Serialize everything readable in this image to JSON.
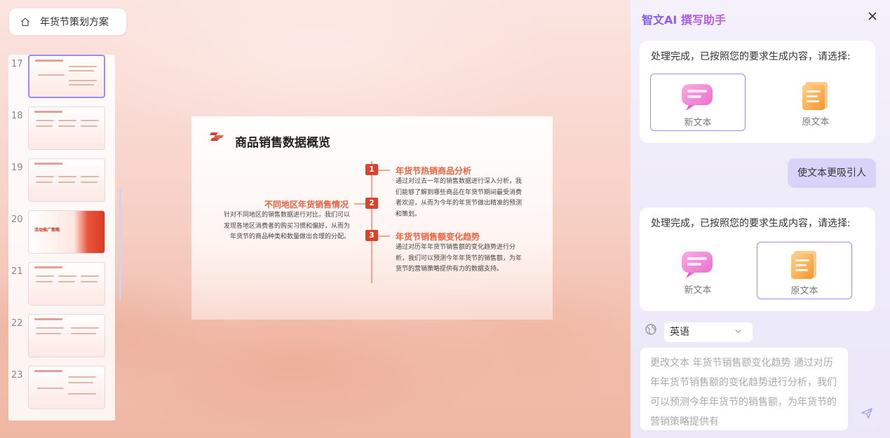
{
  "topbar": {
    "doc_title": "年货节策划方案"
  },
  "thumbnails": [
    {
      "num": "17",
      "active": true
    },
    {
      "num": "18"
    },
    {
      "num": "19"
    },
    {
      "num": "20",
      "badge": "活动推广策略"
    },
    {
      "num": "21"
    },
    {
      "num": "22"
    },
    {
      "num": "23"
    }
  ],
  "slide": {
    "title": "商品销售数据概览",
    "sections": [
      {
        "num": "1",
        "heading": "年货节热销商品分析",
        "body": "通过对过去一年的销售数据进行深入分析，我们能够了解到哪些商品在年货节期间最受消费者欢迎，从而为今年的年货节做出精准的预测和策划。"
      },
      {
        "num": "2",
        "heading": "不同地区年货销售情况",
        "body": "针对不同地区的销售数据进行对比，我们可以发现各地区消费者的购买习惯和偏好，从而为年货节的商品种类和数量做出合理的分配。"
      },
      {
        "num": "3",
        "heading": "年货节销售额变化趋势",
        "body": "通过对历年年货节销售额的变化趋势进行分析，我们可以预测今年年货节的销售额，为年货节的营销策略提供有力的数据支持。"
      }
    ]
  },
  "assistant": {
    "title": "智文AI 撰写助手",
    "messages": [
      {
        "text": "处理完成，已按照您的要求生成内容，请选择:",
        "options": [
          "新文本",
          "原文本"
        ],
        "selected": 0
      },
      {
        "user": "使文本更吸引人"
      },
      {
        "text": "处理完成，已按照您的要求生成内容，请选择:",
        "options": [
          "新文本",
          "原文本"
        ],
        "selected": 1
      }
    ],
    "language": "英语",
    "input_text": "更改文本 年货节销售额变化趋势 通过对历年年货节销售额的变化趋势进行分析，我们可以预测今年年货节的销售额，为年货节的营销策略提供有"
  },
  "colors": {
    "accent": "#d8432e",
    "brand_purple": "#7b5cf0"
  }
}
